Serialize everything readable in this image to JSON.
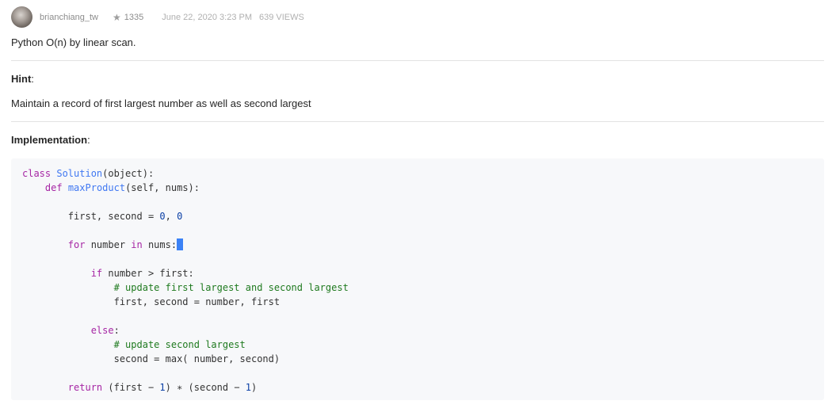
{
  "post": {
    "author": "brianchiang_tw",
    "reputation": "1335",
    "date": "June 22, 2020 3:23 PM",
    "views": "639 VIEWS",
    "summary": "Python O(n) by linear scan.",
    "hint_title": "Hint",
    "hint_colon": ":",
    "hint_text": "Maintain a record of first largest number as well as second largest",
    "impl_title": "Implementation",
    "impl_colon": ":"
  },
  "code": {
    "l1_kw": "class",
    "l1_name": "Solution",
    "l1_rest": "(object):",
    "l2_kw": "def",
    "l2_name": "maxProduct",
    "l2_rest": "(self, nums):",
    "l4_a": "first, second = ",
    "l4_n1": "0",
    "l4_b": ", ",
    "l4_n2": "0",
    "l6_kw": "for",
    "l6_a": " number ",
    "l6_in": "in",
    "l6_b": " nums:",
    "l8_kw": "if",
    "l8_rest": " number > first:",
    "l9_comment": "# update first largest and second largest",
    "l10": "first, second = number, first",
    "l12_kw": "else",
    "l12_rest": ":",
    "l13_comment": "# update second largest",
    "l14": "second = max( number, second)",
    "l16_kw": "return",
    "l16_a": " (first − ",
    "l16_n1": "1",
    "l16_b": ") ∗ (second − ",
    "l16_n2": "1",
    "l16_c": ")"
  },
  "icons": {
    "star": "★"
  },
  "colors": {
    "keyword": "#a626a4",
    "function": "#4078f2",
    "number": "#0a3fa5",
    "comment": "#1f7a1f",
    "cursor": "#3b82f6"
  }
}
